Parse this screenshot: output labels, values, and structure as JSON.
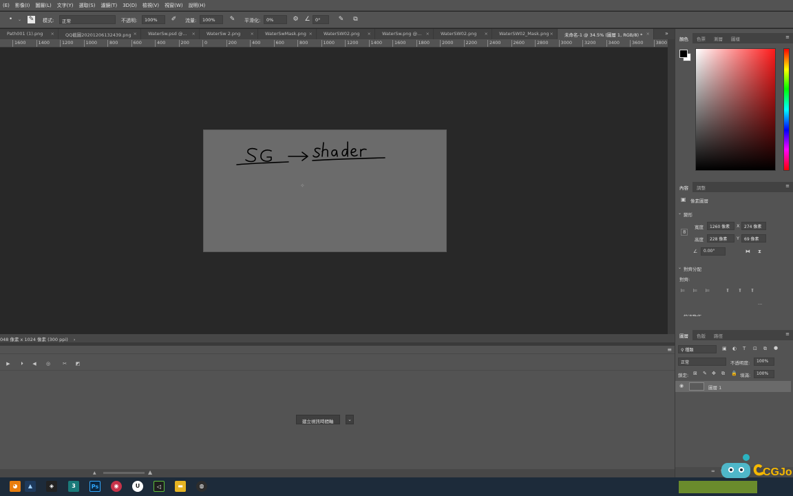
{
  "menu": [
    "(E)",
    "影像(I)",
    "圖層(L)",
    "文字(Y)",
    "選取(S)",
    "濾鏡(T)",
    "3D(D)",
    "檢視(V)",
    "視窗(W)",
    "說明(H)"
  ],
  "options": {
    "mode_label": "模式:",
    "mode_value": "正常",
    "opacity_label": "不透明:",
    "opacity_value": "100%",
    "flow_label": "流量:",
    "flow_value": "100%",
    "smoothing_label": "平滑化:",
    "smoothing_value": "0%",
    "angle_value": "0°"
  },
  "tabs": [
    {
      "label": "Path001 (1).png",
      "active": false
    },
    {
      "label": "QQ截圖20201206132439.png",
      "active": false
    },
    {
      "label": "WaterSw.psd @...",
      "active": false
    },
    {
      "label": "WaterSw 2.png",
      "active": false
    },
    {
      "label": "WaterSwMask.png",
      "active": false
    },
    {
      "label": "WaterSW02.png",
      "active": false
    },
    {
      "label": "WaterSw.png @...",
      "active": false
    },
    {
      "label": "WaterSW02.png",
      "active": false
    },
    {
      "label": "WaterSW02_Mask.png",
      "active": false
    },
    {
      "label": "未命名-1 @ 34.5% (圖層 1, RGB/8) *",
      "active": true
    }
  ],
  "ruler": [
    "1600",
    "1400",
    "1200",
    "1000",
    "800",
    "600",
    "400",
    "200",
    "0",
    "200",
    "400",
    "600",
    "800",
    "1000",
    "1200",
    "1400",
    "1600",
    "1800",
    "2000",
    "2200",
    "2400",
    "2600",
    "2800",
    "3000",
    "3200",
    "3400",
    "3600",
    "3800"
  ],
  "canvas": {
    "handwriting": "SG → shader"
  },
  "status": "048 像素 x 1024 像素 (300 ppi)",
  "status_arrow": "›",
  "timeline": {
    "create_button": "建立視訊時間軸"
  },
  "panels": {
    "color_tabs": [
      "顏色",
      "色票",
      "漸層",
      "圖樣"
    ],
    "props_tabs": [
      "內容",
      "調整"
    ],
    "pixel_layer": "像素圖層",
    "transform_title": "變形",
    "width_label": "寬度",
    "width_value": "1260 像素",
    "height_label": "高度",
    "height_value": "228 像素",
    "x_label": "X",
    "x_value": "274 像素",
    "y_label": "Y",
    "y_value": "69 像素",
    "angle_value": "0.00°",
    "align_title": "對齊分配",
    "align_label": "對齊:",
    "more": "...",
    "cut_title": "快速動作",
    "layers_tabs": [
      "圖層",
      "色版",
      "路徑"
    ],
    "filter_kind": "種類",
    "blend_mode": "正常",
    "opacity_label": "不透明度:",
    "opacity_value": "100%",
    "lock_label": "鎖定:",
    "fill_label": "填滿:",
    "fill_value": "100%",
    "layer_name": "圖層 1"
  },
  "taskbar": {
    "icons": [
      "blender-icon",
      "affinity-icon",
      "unity-icon",
      "3dsmax-icon",
      "photoshop-icon",
      "recorder-icon",
      "unreal-icon",
      "vscode-icon",
      "folder-icon",
      "chrome-icon"
    ]
  },
  "watermark": "CGJo"
}
